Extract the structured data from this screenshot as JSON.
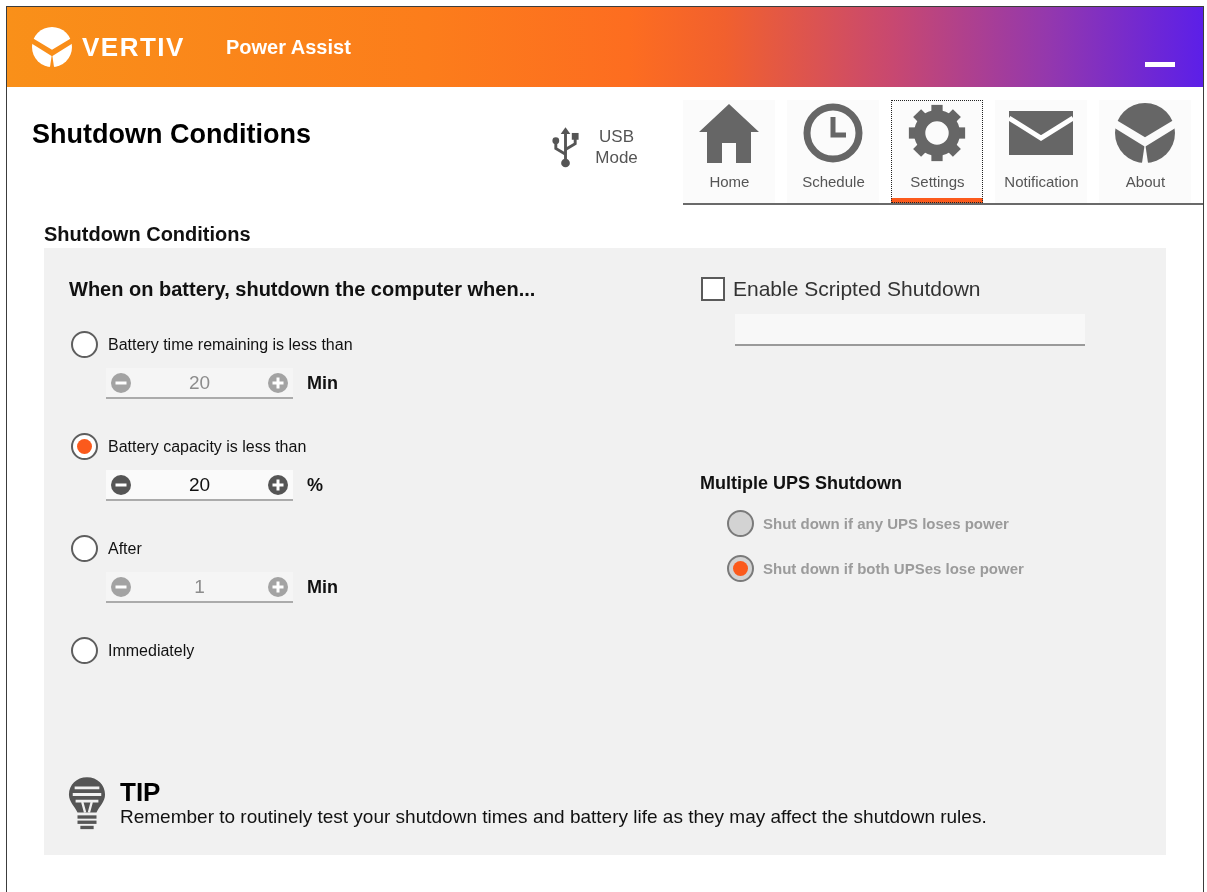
{
  "header": {
    "logo_text": "VERTIV",
    "app_title": "Power Assist"
  },
  "page_title": "Shutdown Conditions",
  "connection_mode": "USB Mode",
  "nav_tabs": [
    {
      "label": "Home",
      "kind": "home",
      "selected": false
    },
    {
      "label": "Schedule",
      "kind": "schedule",
      "selected": false
    },
    {
      "label": "Settings",
      "kind": "settings",
      "selected": true
    },
    {
      "label": "Notification",
      "kind": "notification",
      "selected": false
    },
    {
      "label": "About",
      "kind": "about",
      "selected": false
    }
  ],
  "section_title": "Shutdown Conditions",
  "battery_conditions": {
    "heading": "When on battery, shutdown the computer when...",
    "options": [
      {
        "label": "Battery time remaining is less than",
        "selected": false,
        "spinner": {
          "value": "20",
          "unit": "Min",
          "disabled": true
        }
      },
      {
        "label": "Battery capacity is less than",
        "selected": true,
        "spinner": {
          "value": "20",
          "unit": "%",
          "disabled": false
        }
      },
      {
        "label": "After",
        "selected": false,
        "spinner": {
          "value": "1",
          "unit": "Min",
          "disabled": true
        }
      },
      {
        "label": "Immediately",
        "selected": false
      }
    ]
  },
  "scripted_shutdown": {
    "label": "Enable Scripted Shutdown",
    "checked": false
  },
  "multiple_ups": {
    "heading": "Multiple UPS Shutdown",
    "options": [
      {
        "label": "Shut down if any UPS loses power",
        "selected": false,
        "disabled": true
      },
      {
        "label": "Shut down if both UPSes lose power",
        "selected": true,
        "disabled": true
      }
    ]
  },
  "tip": {
    "title": "TIP",
    "text": "Remember to routinely test your shutdown times and battery life as they may affect the shutdown rules."
  }
}
